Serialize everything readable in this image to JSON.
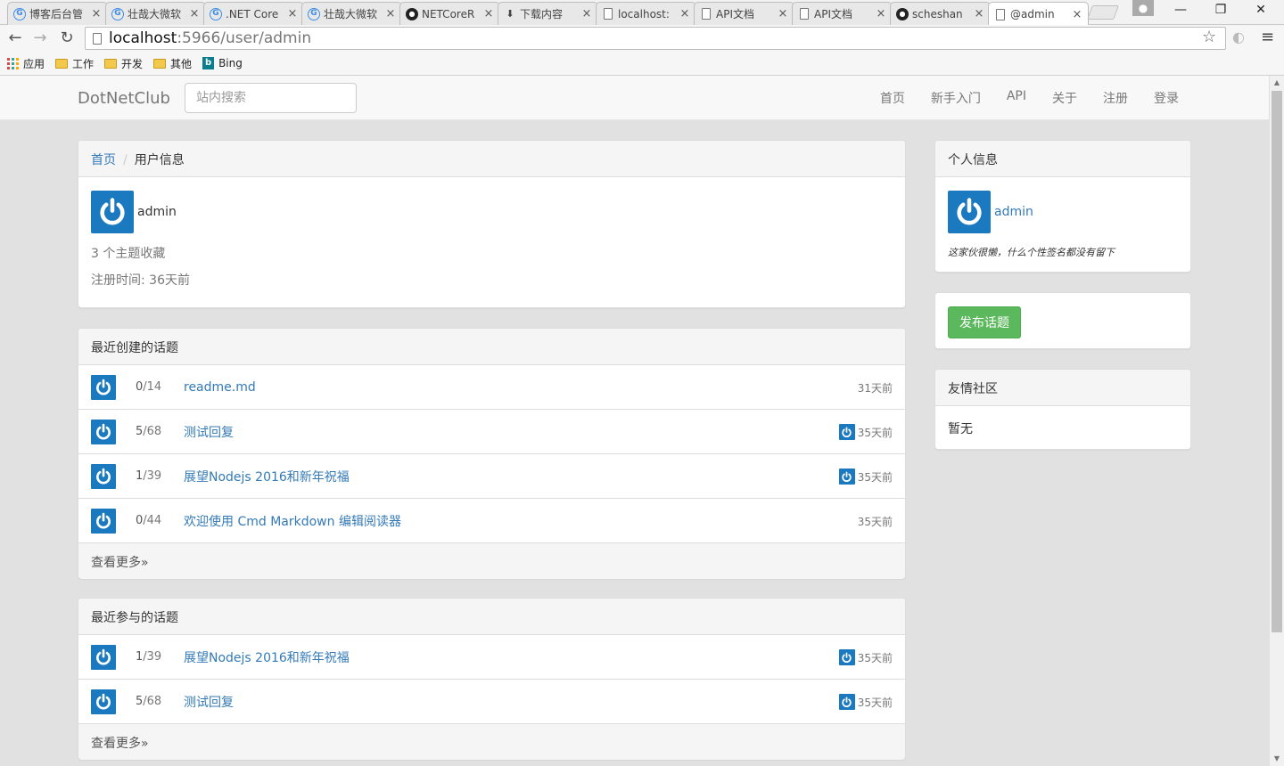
{
  "browser": {
    "tabs": [
      {
        "label": "博客后台管",
        "icon": "blog-icon"
      },
      {
        "label": "壮哉大微软",
        "icon": "blog-icon"
      },
      {
        "label": ".NET Core",
        "icon": "blog-icon"
      },
      {
        "label": "壮哉大微软",
        "icon": "blog-icon"
      },
      {
        "label": "NETCoreR",
        "icon": "github-icon"
      },
      {
        "label": "下载内容",
        "icon": "download-icon"
      },
      {
        "label": "localhost:",
        "icon": "page-icon"
      },
      {
        "label": "API文档",
        "icon": "page-icon"
      },
      {
        "label": "API文档",
        "icon": "page-icon"
      },
      {
        "label": "scheshan",
        "icon": "github-icon"
      },
      {
        "label": "@admin",
        "icon": "page-icon"
      }
    ],
    "close_glyph": "×",
    "url_host": "localhost",
    "url_path": ":5966/user/admin",
    "bookmarks": [
      "应用",
      "工作",
      "开发",
      "其他",
      "Bing"
    ]
  },
  "navbar": {
    "brand": "DotNetClub",
    "search_placeholder": "站内搜索",
    "links": [
      "首页",
      "新手入门",
      "API",
      "关于",
      "注册",
      "登录"
    ]
  },
  "user_panel": {
    "breadcrumb_home": "首页",
    "breadcrumb_sep": "/",
    "breadcrumb_current": "用户信息",
    "username": "admin",
    "favorites": "3 个主题收藏",
    "registered": "注册时间: 36天前"
  },
  "recent_created": {
    "header": "最近创建的话题",
    "topics": [
      {
        "replies": "0",
        "views": "/14",
        "title": "readme.md",
        "time": "31天前",
        "reply_avatar": false
      },
      {
        "replies": "5",
        "views": "/68",
        "title": "测试回复",
        "time": "35天前",
        "reply_avatar": true
      },
      {
        "replies": "1",
        "views": "/39",
        "title": "展望Nodejs 2016和新年祝福",
        "time": "35天前",
        "reply_avatar": true
      },
      {
        "replies": "0",
        "views": "/44",
        "title": "欢迎使用 Cmd Markdown 编辑阅读器",
        "time": "35天前",
        "reply_avatar": false
      }
    ],
    "more": "查看更多»"
  },
  "recent_joined": {
    "header": "最近参与的话题",
    "topics": [
      {
        "replies": "1",
        "views": "/39",
        "title": "展望Nodejs 2016和新年祝福",
        "time": "35天前",
        "reply_avatar": true
      },
      {
        "replies": "5",
        "views": "/68",
        "title": "测试回复",
        "time": "35天前",
        "reply_avatar": true
      }
    ],
    "more": "查看更多»"
  },
  "sidebar": {
    "profile_header": "个人信息",
    "profile_name": "admin",
    "signature": "这家伙很懒，什么个性签名都没有留下",
    "publish_button": "发布话题",
    "friends_header": "友情社区",
    "friends_empty": "暂无"
  },
  "colors": {
    "link": "#337ab7",
    "avatar": "#1b79c0",
    "success": "#5cb85c"
  }
}
